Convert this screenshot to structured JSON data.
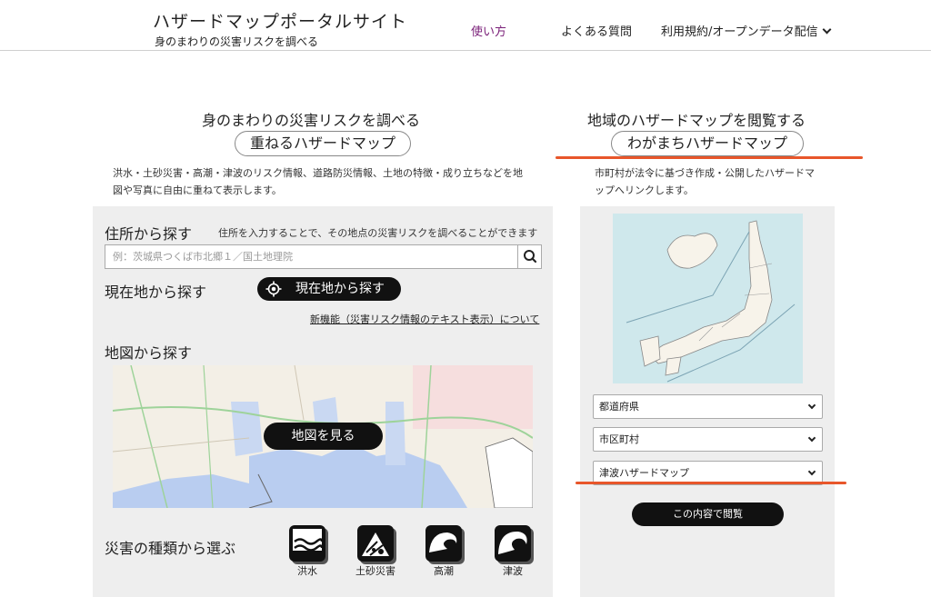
{
  "header": {
    "site_title": "ハザードマップポータルサイト",
    "site_subtitle": "身のまわりの災害リスクを調べる",
    "nav": {
      "howto": "使い方",
      "faq": "よくある質問",
      "terms": "利用規約/オープンデータ配信"
    }
  },
  "left": {
    "heading": "身のまわりの災害リスクを調べる",
    "pill_title": "重ねるハザードマップ",
    "description_line1": "洪水・土砂災害・高潮・津波のリスク情報、道路防災情報、土地の特徴・成り立ちなどを地",
    "description_line2": "図や写真に自由に重ねて表示します。",
    "address_search": {
      "label": "住所から探す",
      "hint": "住所を入力することで、その地点の災害リスクを調べることができます",
      "placeholder": "例：茨城県つくば市北郷１／国土地理院"
    },
    "current_location": {
      "label": "現在地から探す",
      "button": "現在地から探す"
    },
    "new_feature_link": "新機能（災害リスク情報のテキスト表示）について",
    "map_search": {
      "label": "地図から探す",
      "button": "地図を見る"
    },
    "disaster_types": {
      "label": "災害の種類から選ぶ",
      "items": [
        "洪水",
        "土砂災害",
        "高潮",
        "津波"
      ]
    }
  },
  "right": {
    "heading": "地域のハザードマップを閲覧する",
    "pill_title": "わがまちハザードマップ",
    "description_line1": "市町村が法令に基づき作成・公開したハザードマ",
    "description_line2": "ップへリンクします。",
    "selects": {
      "prefecture": "都道府県",
      "municipality": "市区町村",
      "map_type": "津波ハザードマップ"
    },
    "view_button": "この内容で閲覧"
  },
  "colors": {
    "accent_nav": "#7a1f78",
    "underline": "#e8562a",
    "panel_bg": "#eeeeee",
    "button_bg": "#111111"
  }
}
